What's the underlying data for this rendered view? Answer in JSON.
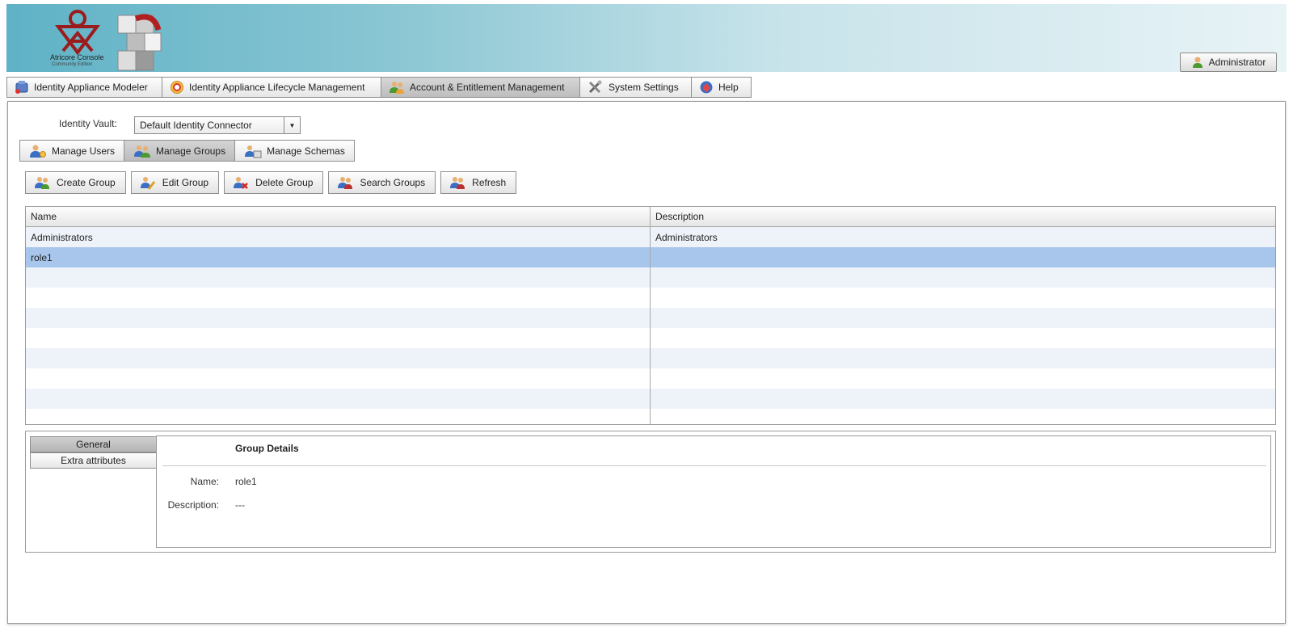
{
  "header": {
    "logo_title": "Atricore Console",
    "logo_subtitle": "Community Edition",
    "user_label": "Administrator"
  },
  "topnav": {
    "tabs": [
      {
        "label": "Identity Appliance Modeler",
        "icon": "appliance-modeler-icon"
      },
      {
        "label": "Identity Appliance Lifecycle Management",
        "icon": "lifecycle-icon"
      },
      {
        "label": "Account & Entitlement Management",
        "icon": "account-management-icon",
        "active": true
      },
      {
        "label": "System Settings",
        "icon": "tools-icon"
      },
      {
        "label": "Help",
        "icon": "help-icon"
      }
    ]
  },
  "vault": {
    "label": "Identity Vault:",
    "selected": "Default Identity Connector"
  },
  "subtabs": [
    {
      "label": "Manage Users"
    },
    {
      "label": "Manage Groups",
      "active": true
    },
    {
      "label": "Manage Schemas"
    }
  ],
  "toolbar": {
    "create": "Create Group",
    "edit": "Edit Group",
    "delete": "Delete Group",
    "search": "Search Groups",
    "refresh": "Refresh"
  },
  "grid": {
    "columns": [
      "Name",
      "Description"
    ],
    "rows": [
      [
        "Administrators",
        "Administrators"
      ],
      [
        "role1",
        ""
      ]
    ],
    "selected_row": 1
  },
  "detail": {
    "tabs": [
      "General",
      "Extra attributes"
    ],
    "title": "Group Details",
    "name_label": "Name:",
    "name_value": "role1",
    "description_label": "Description:",
    "description_value": "---"
  },
  "colors": {
    "header_gradient_start": "#5fb2c6",
    "header_gradient_end": "#e8f3f6",
    "row_selected": "#a8c6ec",
    "row_alt": "#eef3fa",
    "logo_red": "#9b1c1c"
  }
}
